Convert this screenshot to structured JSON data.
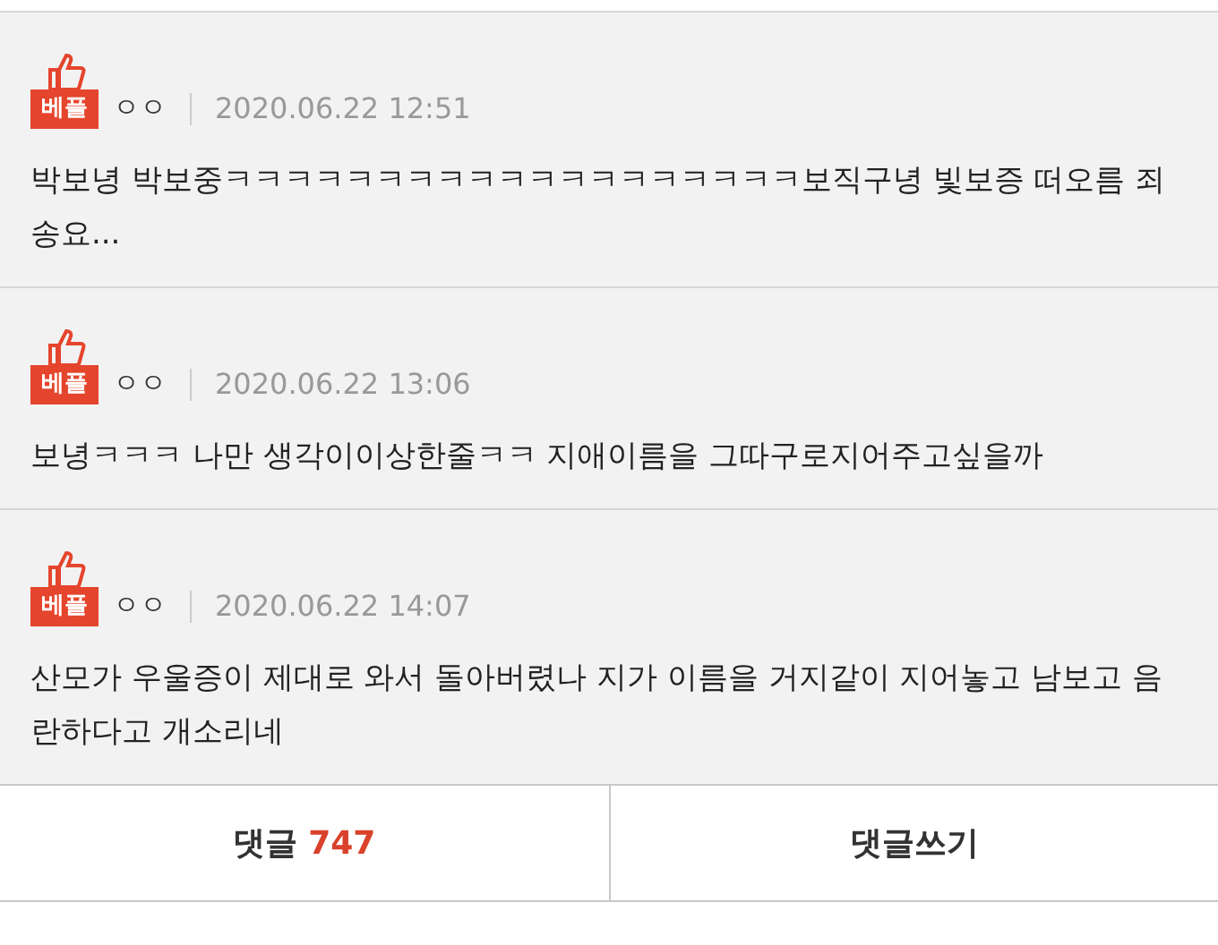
{
  "comments": [
    {
      "best": true,
      "badge": "베플",
      "author": "ㅇㅇ",
      "date": "2020.06.22 12:51",
      "text": "박보녕 박보중ㅋㅋㅋㅋㅋㅋㅋㅋㅋㅋㅋㅋㅋㅋㅋㅋㅋㅋㅋ보직구녕 빛보증 떠오름 죄송요..."
    },
    {
      "best": true,
      "badge": "베플",
      "author": "ㅇㅇ",
      "date": "2020.06.22 13:06",
      "text": "보녕ㅋㅋㅋ 나만 생각이이상한줄ㅋㅋ 지애이름을 그따구로지어주고싶을까"
    },
    {
      "best": true,
      "badge": "베플",
      "author": "ㅇㅇ",
      "date": "2020.06.22 14:07",
      "text": "산모가 우울증이 제대로 와서 돌아버렸나 지가 이름을 거지같이 지어놓고 남보고 음란하다고 개소리네"
    }
  ],
  "footer": {
    "comments_label": "댓글",
    "comments_count": "747",
    "write_label": "댓글쓰기"
  }
}
